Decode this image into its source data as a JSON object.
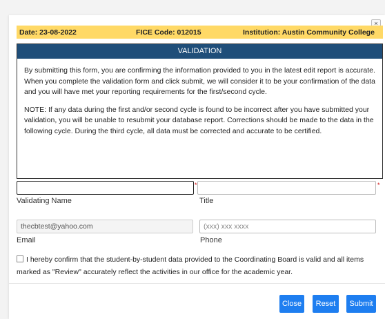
{
  "header": {
    "close_glyph": "×",
    "date": "Date: 23-08-2022",
    "fice": "FICE Code: 012015",
    "institution": "Institution: Austin Community College"
  },
  "validation": {
    "title": "VALIDATION",
    "paragraph1": "By submitting this form, you are confirming the information provided to you in the latest edit report is accurate. When you complete the validation form and click submit, we will consider it to be your confirmation of the data and you will have met your reporting requirements for the first/second cycle.",
    "paragraph2": "NOTE: If any data during the first and/or second cycle is found to be incorrect after you have submitted your validation, you will be unable to resubmit your database report. Corrections should be made to the data in the following cycle. During the third cycle, all data must be corrected and accurate to be certified."
  },
  "form": {
    "validating_name": {
      "label": "Validating Name",
      "value": "",
      "required_mark": "*"
    },
    "title": {
      "label": "Title",
      "value": "",
      "required_mark": "*"
    },
    "email": {
      "label": "Email",
      "value": "thecbtest@yahoo.com"
    },
    "phone": {
      "label": "Phone",
      "placeholder": "(xxx) xxx xxxx"
    },
    "confirm": {
      "checked": false,
      "text": "I hereby confirm that the student-by-student data provided to the Coordinating Board is valid and all items marked as \"Review\" accurately reflect the activities in our office for the academic year."
    }
  },
  "buttons": {
    "close": "Close",
    "reset": "Reset",
    "submit": "Submit"
  },
  "colors": {
    "info_bar": "#ffd966",
    "validation_header": "#1f4e79",
    "button": "#1e7ef0",
    "required": "#cc0000"
  }
}
